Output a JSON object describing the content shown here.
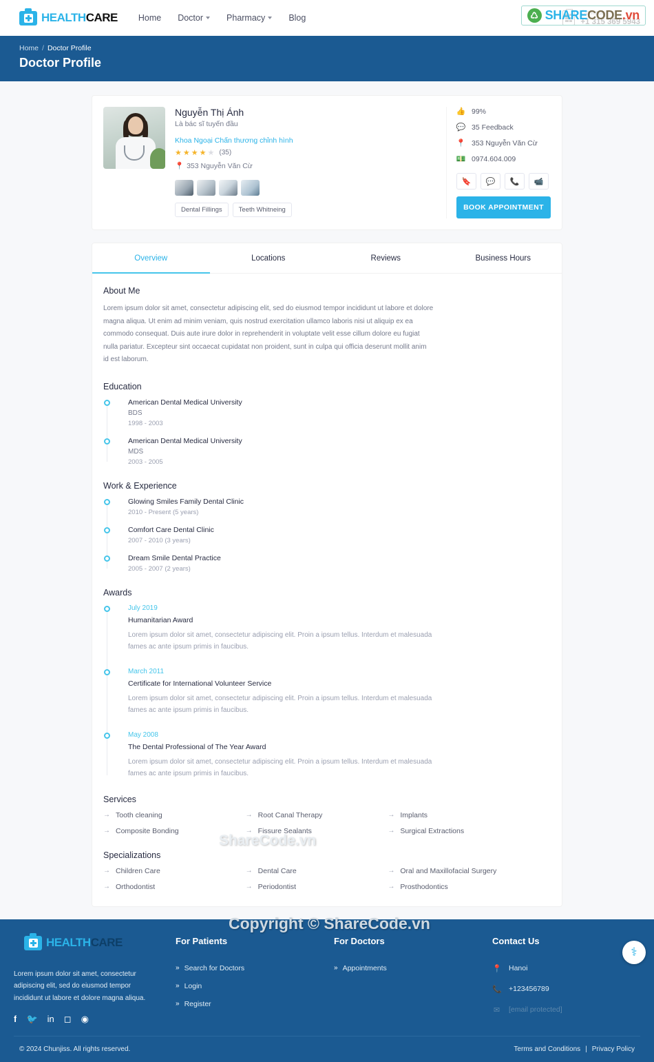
{
  "nav": {
    "logo": {
      "first": "HEALTH",
      "second": "CARE",
      "icon": "medical-bag-icon"
    },
    "links": [
      {
        "label": "Home",
        "caret": false
      },
      {
        "label": "Doctor",
        "caret": true
      },
      {
        "label": "Pharmacy",
        "caret": true
      },
      {
        "label": "Blog",
        "caret": false
      }
    ],
    "contact": {
      "label": "Contact",
      "phone": "+1 315 369 5943"
    }
  },
  "breadcrumb": {
    "home": "Home",
    "sep": "/",
    "current": "Doctor Profile",
    "title": "Doctor Profile"
  },
  "doctor": {
    "name": "Nguyễn Thị Ánh",
    "subtitle": "Là bác sĩ tuyến đầu",
    "specialty": "Khoa Ngoại Chấn thương chỉnh hình",
    "rating_stars": 4,
    "rating_count": "(35)",
    "location": "353 Nguyễn Văn Cừ",
    "tags": [
      "Dental Fillings",
      "Teeth Whitneing"
    ],
    "stats": [
      {
        "icon": "thumbs-up-icon",
        "value": "99%"
      },
      {
        "icon": "comment-icon",
        "value": "35 Feedback"
      },
      {
        "icon": "map-pin-icon",
        "value": "353 Nguyễn Văn Cừ"
      },
      {
        "icon": "money-icon",
        "value": "0974.604.009"
      }
    ],
    "action_icons": [
      "bookmark-icon",
      "chat-icon",
      "phone-icon",
      "video-icon"
    ],
    "book_button": "BOOK APPOINTMENT"
  },
  "tabs": [
    {
      "label": "Overview",
      "active": true
    },
    {
      "label": "Locations",
      "active": false
    },
    {
      "label": "Reviews",
      "active": false
    },
    {
      "label": "Business Hours",
      "active": false
    }
  ],
  "overview": {
    "about_heading": "About Me",
    "about_text": "Lorem ipsum dolor sit amet, consectetur adipiscing elit, sed do eiusmod tempor incididunt ut labore et dolore magna aliqua. Ut enim ad minim veniam, quis nostrud exercitation ullamco laboris nisi ut aliquip ex ea commodo consequat. Duis aute irure dolor in reprehenderit in voluptate velit esse cillum dolore eu fugiat nulla pariatur. Excepteur sint occaecat cupidatat non proident, sunt in culpa qui officia deserunt mollit anim id est laborum.",
    "education_heading": "Education",
    "education": [
      {
        "school": "American Dental Medical University",
        "degree": "BDS",
        "years": "1998 - 2003"
      },
      {
        "school": "American Dental Medical University",
        "degree": "MDS",
        "years": "2003 - 2005"
      }
    ],
    "work_heading": "Work & Experience",
    "work": [
      {
        "place": "Glowing Smiles Family Dental Clinic",
        "years": "2010 - Present (5 years)"
      },
      {
        "place": "Comfort Care Dental Clinic",
        "years": "2007 - 2010 (3 years)"
      },
      {
        "place": "Dream Smile Dental Practice",
        "years": "2005 - 2007 (2 years)"
      }
    ],
    "awards_heading": "Awards",
    "awards": [
      {
        "date": "July 2019",
        "title": "Humanitarian Award",
        "text": "Lorem ipsum dolor sit amet, consectetur adipiscing elit. Proin a ipsum tellus. Interdum et malesuada fames ac ante ipsum primis in faucibus."
      },
      {
        "date": "March 2011",
        "title": "Certificate for International Volunteer Service",
        "text": "Lorem ipsum dolor sit amet, consectetur adipiscing elit. Proin a ipsum tellus. Interdum et malesuada fames ac ante ipsum primis in faucibus."
      },
      {
        "date": "May 2008",
        "title": "The Dental Professional of The Year Award",
        "text": "Lorem ipsum dolor sit amet, consectetur adipiscing elit. Proin a ipsum tellus. Interdum et malesuada fames ac ante ipsum primis in faucibus."
      }
    ],
    "services_heading": "Services",
    "services": [
      "Tooth cleaning",
      "Root Canal Therapy",
      "Implants",
      "Composite Bonding",
      "Fissure Sealants",
      "Surgical Extractions"
    ],
    "specializations_heading": "Specializations",
    "specializations": [
      "Children Care",
      "Dental Care",
      "Oral and Maxillofacial Surgery",
      "Orthodontist",
      "Periodontist",
      "Prosthodontics"
    ]
  },
  "footer": {
    "logo": {
      "first": "HEALTH",
      "second": "CARE"
    },
    "description": "Lorem ipsum dolor sit amet, consectetur adipiscing elit, sed do eiusmod tempor incididunt ut labore et dolore magna aliqua.",
    "social": [
      "facebook-icon",
      "twitter-icon",
      "linkedin-icon",
      "instagram-icon",
      "dribbble-icon"
    ],
    "patients_heading": "For Patients",
    "patients_links": [
      "Search for Doctors",
      "Login",
      "Register"
    ],
    "doctors_heading": "For Doctors",
    "doctors_links": [
      "Appointments"
    ],
    "contact_heading": "Contact Us",
    "contact_items": [
      {
        "icon": "map-pin-icon",
        "value": "Hanoi",
        "muted": false
      },
      {
        "icon": "phone-icon",
        "value": "+123456789",
        "muted": false
      },
      {
        "icon": "mail-icon",
        "value": "[email protected]",
        "muted": true
      }
    ],
    "copyright": "© 2024 Chunjiss. All rights reserved.",
    "terms": "Terms and Conditions",
    "divider": "|",
    "privacy": "Privacy Policy"
  },
  "watermarks": {
    "brand_share": "SHARE",
    "brand_code": "CODE",
    "brand_vn": ".vn",
    "mid": "ShareCode.vn",
    "big": "Copyright © ShareCode.vn"
  },
  "fab": {
    "icon": "stethoscope-icon"
  },
  "colors": {
    "primary": "#2bb3e8",
    "dark_blue": "#1b5a92",
    "star": "#f5b42a",
    "text": "#272b41"
  }
}
